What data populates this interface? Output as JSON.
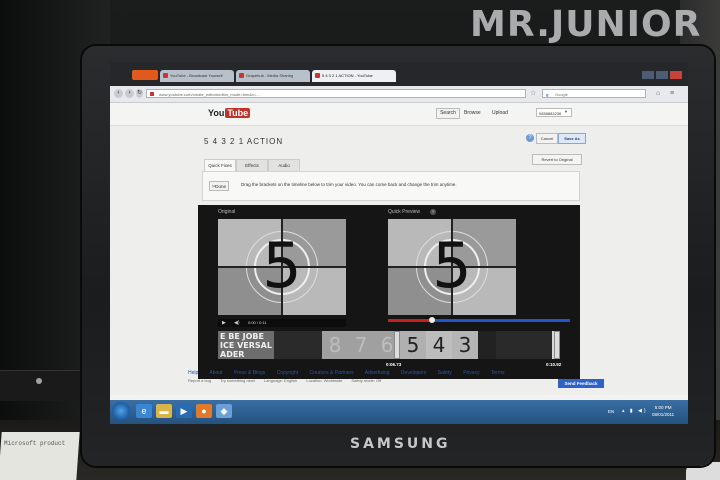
{
  "watermark": "MR.JUNIOR",
  "monitor_brand": "SAMSUNG",
  "browser": {
    "tabs": [
      {
        "label": "YouTube - Broadcast Yourself"
      },
      {
        "label": "Grapehub - Media Sharing"
      },
      {
        "label": "5 4 3 2 1 ACTION - YouTube"
      }
    ],
    "url": "www.youtube.com/create_editor#editor_mode=trim&v=...",
    "search_placeholder": "Google"
  },
  "youtube": {
    "logo_you": "You",
    "logo_tube": "Tube",
    "search_button": "Search",
    "browse_link": "Browse",
    "upload_link": "Upload",
    "account": "0858883236",
    "video_title": "5 4 3 2 1 ACTION",
    "cancel_button": "Cancel",
    "save_button": "Save As",
    "revert_button": "Revert to Original",
    "tabs": [
      "Quick Fixes",
      "Effects",
      "Audio"
    ],
    "done_button": "Done",
    "instructions": "Drag the brackets on the timeline below to trim your video. You can come back and change the trim anytime.",
    "original_label": "Original",
    "preview_label": "Quick Preview",
    "countdown_digit": "5",
    "player_time": "0:00 / 0:11",
    "preview_progress": 0.24,
    "timeline": {
      "text_thumb_1": "E BE JOBE",
      "text_thumb_2": "ICE VERSAL",
      "text_thumb_3": "ADER",
      "digits": [
        "8",
        "7",
        "6",
        "5",
        "4",
        "3"
      ],
      "start_time": "0:06.73",
      "end_time": "0:10.92"
    },
    "feedback_button": "Send Feedback",
    "footer_links": [
      "Help",
      "About",
      "Press & Blogs",
      "Copyright",
      "Creators & Partners",
      "Advertising",
      "Developers",
      "Safety",
      "Privacy",
      "Terms"
    ],
    "footer_meta": [
      "Report a bug",
      "Try something new!",
      "Language: English",
      "Location: Worldwide",
      "Safety mode: Off"
    ]
  },
  "taskbar": {
    "lang": "EN",
    "time": "5:00 PM",
    "date": "08/01/2011"
  },
  "colors": {
    "youtube_red": "#c0332b",
    "feedback_blue": "#2f62c6",
    "progress_red": "#c72020",
    "progress_blue": "#2156c9",
    "taskbar_blue": "#2c5d8f"
  },
  "paper_note": "Microsoft product"
}
